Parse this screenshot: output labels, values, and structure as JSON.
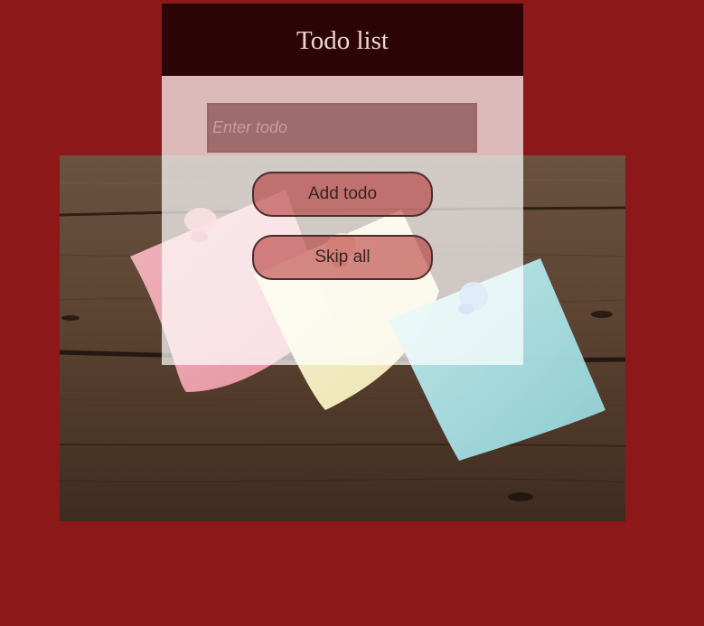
{
  "app": {
    "title": "Todo list"
  },
  "form": {
    "input_placeholder": "Enter todo",
    "input_value": ""
  },
  "buttons": {
    "add_label": "Add todo",
    "skip_label": "Skip all"
  },
  "background": {
    "image_subject": "sticky-notes-on-wood"
  },
  "colors": {
    "page_background": "#8c1819",
    "header_background": "#2c0606",
    "header_text": "#f0d6d3",
    "note_pink": "#f2a9b6",
    "note_yellow": "#f8f2c8",
    "note_blue": "#a7dde2",
    "wood": "#5a4130"
  }
}
